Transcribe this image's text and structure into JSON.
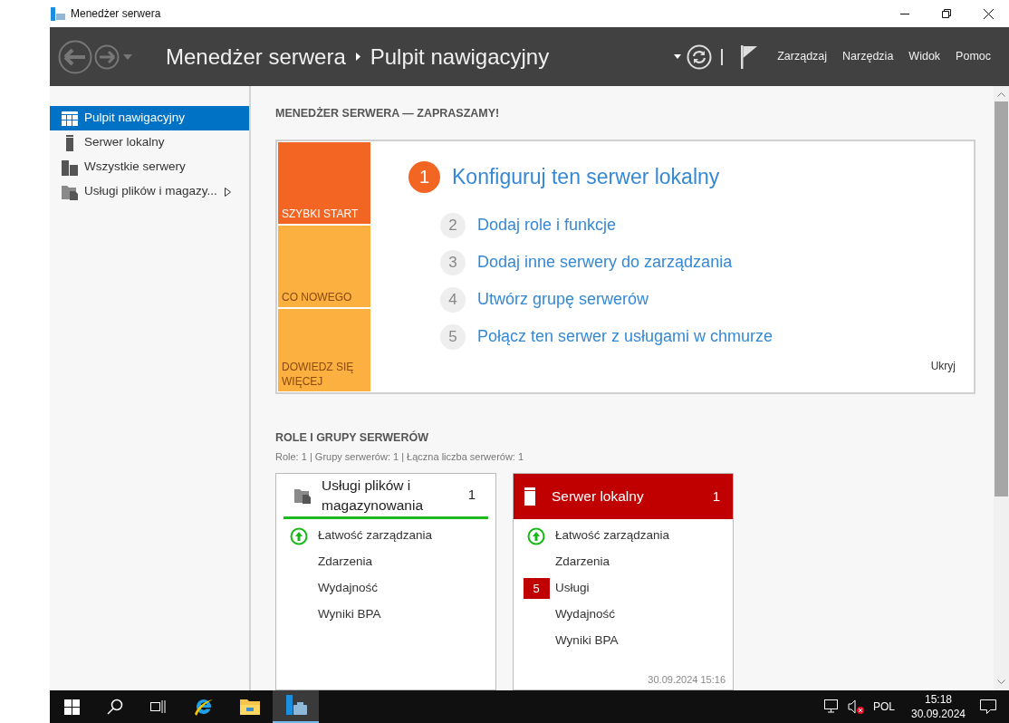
{
  "window": {
    "title": "Menedżer serwera"
  },
  "header": {
    "breadcrumb": [
      "Menedżer serwera",
      "Pulpit nawigacyjny"
    ],
    "menus": [
      "Zarządzaj",
      "Narzędzia",
      "Widok",
      "Pomoc"
    ]
  },
  "sidebar": {
    "items": [
      {
        "label": "Pulpit nawigacyjny",
        "kind": "dashboard",
        "selected": true,
        "expandable": false
      },
      {
        "label": "Serwer lokalny",
        "kind": "server",
        "selected": false,
        "expandable": false
      },
      {
        "label": "Wszystkie serwery",
        "kind": "servers",
        "selected": false,
        "expandable": false
      },
      {
        "label": "Usługi plików i magazy...",
        "kind": "files",
        "selected": false,
        "expandable": true
      }
    ]
  },
  "welcome": {
    "title": "MENEDŻER SERWERA — ZAPRASZAMY!",
    "tiles": [
      {
        "label": "SZYBKI START",
        "color": "#f26522"
      },
      {
        "label": "CO NOWEGO",
        "color": "#fbb040"
      },
      {
        "label": "DOWIEDZ SIĘ WIĘCEJ",
        "color": "#fbb040"
      }
    ],
    "steps": [
      {
        "number": "1",
        "label": "Konfiguruj ten serwer lokalny",
        "kind": "primary"
      },
      {
        "number": "2",
        "label": "Dodaj role i funkcje",
        "kind": "secondary"
      },
      {
        "number": "3",
        "label": "Dodaj inne serwery do zarządzania",
        "kind": "secondary"
      },
      {
        "number": "4",
        "label": "Utwórz grupę serwerów",
        "kind": "secondary"
      },
      {
        "number": "5",
        "label": "Połącz ten serwer z usługami w chmurze",
        "kind": "secondary"
      }
    ],
    "hide": "Ukryj"
  },
  "roles": {
    "title": "ROLE I GRUPY SERWERÓW",
    "summary": "Role: 1 | Grupy serwerów: 1 | Łączna liczba serwerów: 1",
    "cards": [
      {
        "title": "Usługi plików i magazynowania",
        "count": "1",
        "kind": "files",
        "alert": false,
        "rows": [
          {
            "label": "Łatwość zarządzania",
            "kind": "ok"
          },
          {
            "label": "Zdarzenia",
            "kind": "plain"
          },
          {
            "label": "Wydajność",
            "kind": "plain"
          },
          {
            "label": "Wyniki BPA",
            "kind": "plain"
          }
        ]
      },
      {
        "title": "Serwer lokalny",
        "count": "1",
        "kind": "server",
        "alert": true,
        "timestamp": "30.09.2024 15:16",
        "rows": [
          {
            "label": "Łatwość zarządzania",
            "kind": "ok"
          },
          {
            "label": "Zdarzenia",
            "kind": "plain"
          },
          {
            "label": "Usługi",
            "kind": "badge",
            "badge": "5"
          },
          {
            "label": "Wydajność",
            "kind": "plain"
          },
          {
            "label": "Wyniki BPA",
            "kind": "plain"
          }
        ]
      }
    ]
  },
  "taskbar": {
    "apps": [
      {
        "kind": "ie",
        "selected": false
      },
      {
        "kind": "explorer",
        "selected": false
      },
      {
        "kind": "server-manager",
        "selected": true
      }
    ],
    "language": "POL",
    "time": "15:18",
    "date": "30.09.2024"
  }
}
